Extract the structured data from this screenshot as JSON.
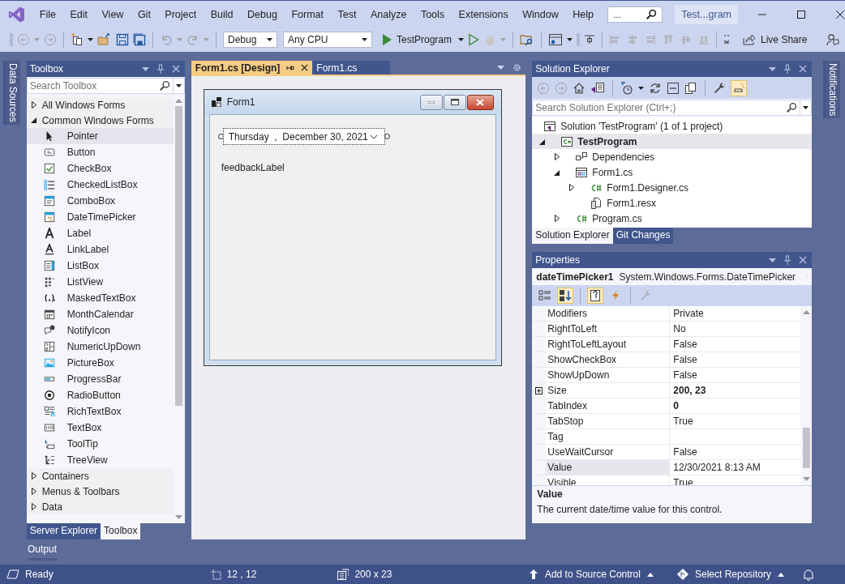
{
  "menu": [
    "File",
    "Edit",
    "View",
    "Git",
    "Project",
    "Build",
    "Debug",
    "Format",
    "Test",
    "Analyze",
    "Tools",
    "Extensions",
    "Window",
    "Help"
  ],
  "quick_launch": {
    "value": "..."
  },
  "window": {
    "title": "Test...gram"
  },
  "toolbar": {
    "configuration": "Debug",
    "platform": "Any CPU",
    "start_target": "TestProgram",
    "live_share": "Live Share"
  },
  "left_side_tabs": [
    "Data Sources"
  ],
  "right_side_tabs": [
    "Notifications"
  ],
  "toolbox": {
    "title": "Toolbox",
    "search": {
      "placeholder": "Search Toolbox"
    },
    "groups": [
      {
        "label": "All Windows Forms",
        "expanded": false
      },
      {
        "label": "Common Windows Forms",
        "expanded": true,
        "items": [
          {
            "label": "Pointer",
            "selected": true
          },
          {
            "label": "Button",
            "selected": false
          },
          {
            "label": "CheckBox",
            "selected": false
          },
          {
            "label": "CheckedListBox",
            "selected": false
          },
          {
            "label": "ComboBox",
            "selected": false
          },
          {
            "label": "DateTimePicker",
            "selected": false
          },
          {
            "label": "Label",
            "selected": false
          },
          {
            "label": "LinkLabel",
            "selected": false
          },
          {
            "label": "ListBox",
            "selected": false
          },
          {
            "label": "ListView",
            "selected": false
          },
          {
            "label": "MaskedTextBox",
            "selected": false
          },
          {
            "label": "MonthCalendar",
            "selected": false
          },
          {
            "label": "NotifyIcon",
            "selected": false
          },
          {
            "label": "NumericUpDown",
            "selected": false
          },
          {
            "label": "PictureBox",
            "selected": false
          },
          {
            "label": "ProgressBar",
            "selected": false
          },
          {
            "label": "RadioButton",
            "selected": false
          },
          {
            "label": "RichTextBox",
            "selected": false
          },
          {
            "label": "TextBox",
            "selected": false
          },
          {
            "label": "ToolTip",
            "selected": false
          },
          {
            "label": "TreeView",
            "selected": false
          }
        ]
      },
      {
        "label": "Containers",
        "expanded": false
      },
      {
        "label": "Menus & Toolbars",
        "expanded": false
      },
      {
        "label": "Data",
        "expanded": false
      }
    ],
    "tabs": [
      {
        "label": "Server Explorer",
        "selected": false
      },
      {
        "label": "Toolbox",
        "selected": true
      }
    ]
  },
  "document": {
    "tabs": [
      {
        "label": "Form1.cs [Design]",
        "selected": true
      },
      {
        "label": "Form1.cs",
        "selected": false
      }
    ],
    "form": {
      "title": "Form1",
      "date_picker": {
        "value": "Thursday  ,  December 30, 2021"
      },
      "label": "feedbackLabel"
    }
  },
  "solution_explorer": {
    "title": "Solution Explorer",
    "search": {
      "placeholder": "Search Solution Explorer (Ctrl+;)"
    },
    "tree": [
      {
        "label": "Solution 'TestProgram' (1 of 1 project)",
        "kind": "solution",
        "selected": false,
        "children": [
          {
            "label": "TestProgram",
            "kind": "project",
            "selected": true,
            "startup": true,
            "expanded": true,
            "children": [
              {
                "label": "Dependencies",
                "kind": "dependencies",
                "selected": false,
                "expanded": false
              },
              {
                "label": "Form1.cs",
                "kind": "form",
                "selected": false,
                "expanded": true,
                "children": [
                  {
                    "label": "Form1.Designer.cs",
                    "kind": "csharp",
                    "selected": false,
                    "expanded": false
                  },
                  {
                    "label": "Form1.resx",
                    "kind": "resource",
                    "selected": false
                  }
                ]
              },
              {
                "label": "Program.cs",
                "kind": "csharp",
                "selected": false,
                "expanded": false
              }
            ]
          }
        ]
      }
    ],
    "tabs": [
      {
        "label": "Solution Explorer",
        "selected": true
      },
      {
        "label": "Git Changes",
        "selected": false
      }
    ]
  },
  "properties": {
    "title": "Properties",
    "object_name": "dateTimePicker1",
    "object_type": "System.Windows.Forms.DateTimePicker",
    "view_buttons": [
      {
        "kind": "categorized",
        "selected": false
      },
      {
        "kind": "alphabetical",
        "selected": true
      },
      {
        "kind": "properties",
        "selected": true
      },
      {
        "kind": "events",
        "selected": false
      },
      {
        "kind": "property-pages",
        "selected": false,
        "disabled": true
      }
    ],
    "rows": [
      {
        "name": "Modifiers",
        "value": "Private",
        "modified": false,
        "selected": false
      },
      {
        "name": "RightToLeft",
        "value": "No",
        "modified": false,
        "selected": false
      },
      {
        "name": "RightToLeftLayout",
        "value": "False",
        "modified": false,
        "selected": false
      },
      {
        "name": "ShowCheckBox",
        "value": "False",
        "modified": false,
        "selected": false
      },
      {
        "name": "ShowUpDown",
        "value": "False",
        "modified": false,
        "selected": false
      },
      {
        "name": "Size",
        "value": "200, 23",
        "modified": true,
        "selected": false,
        "expandable": true
      },
      {
        "name": "TabIndex",
        "value": "0",
        "modified": true,
        "selected": false
      },
      {
        "name": "TabStop",
        "value": "True",
        "modified": false,
        "selected": false
      },
      {
        "name": "Tag",
        "selected": false
      },
      {
        "name": "UseWaitCursor",
        "value": "False",
        "modified": false,
        "selected": false
      },
      {
        "name": "Value",
        "value": "12/30/2021 8:13 AM",
        "modified": false,
        "selected": true
      },
      {
        "name": "Visible",
        "value": "True",
        "modified": false,
        "selected": false
      }
    ],
    "description": {
      "title": "Value",
      "text": "The current date/time value for this control."
    }
  },
  "output_tab": "Output",
  "status_bar": {
    "state": "Ready",
    "position": "12 , 12",
    "size": "200 x 23",
    "source_control": "Add to Source Control",
    "repository": "Select Repository"
  }
}
